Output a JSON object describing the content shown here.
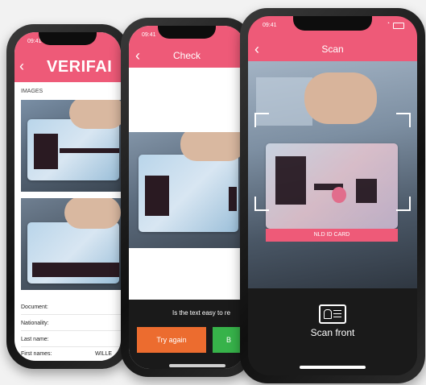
{
  "phone1": {
    "status_time": "09:41",
    "brand": "VERIFAI",
    "section_label": "IMAGES",
    "fields": [
      {
        "label": "Document:",
        "value": ""
      },
      {
        "label": "Nationality:",
        "value": ""
      },
      {
        "label": "Last name:",
        "value": ""
      },
      {
        "label": "First names:",
        "value": "WILLE"
      }
    ]
  },
  "phone2": {
    "status_time": "09:41",
    "title": "Check",
    "question": "Is the text easy to re",
    "try_again_label": "Try again",
    "confirm_label": "B",
    "colors": {
      "try_again": "#ec6c2f",
      "confirm": "#37b34a"
    }
  },
  "phone3": {
    "status_time": "09:41",
    "title": "Scan",
    "card_type_label": "NLD ID CARD",
    "instruction": "Scan front",
    "icon": "id-card-icon"
  },
  "colors": {
    "brand_pink": "#ee5a78",
    "dark": "#1a1a1a"
  }
}
